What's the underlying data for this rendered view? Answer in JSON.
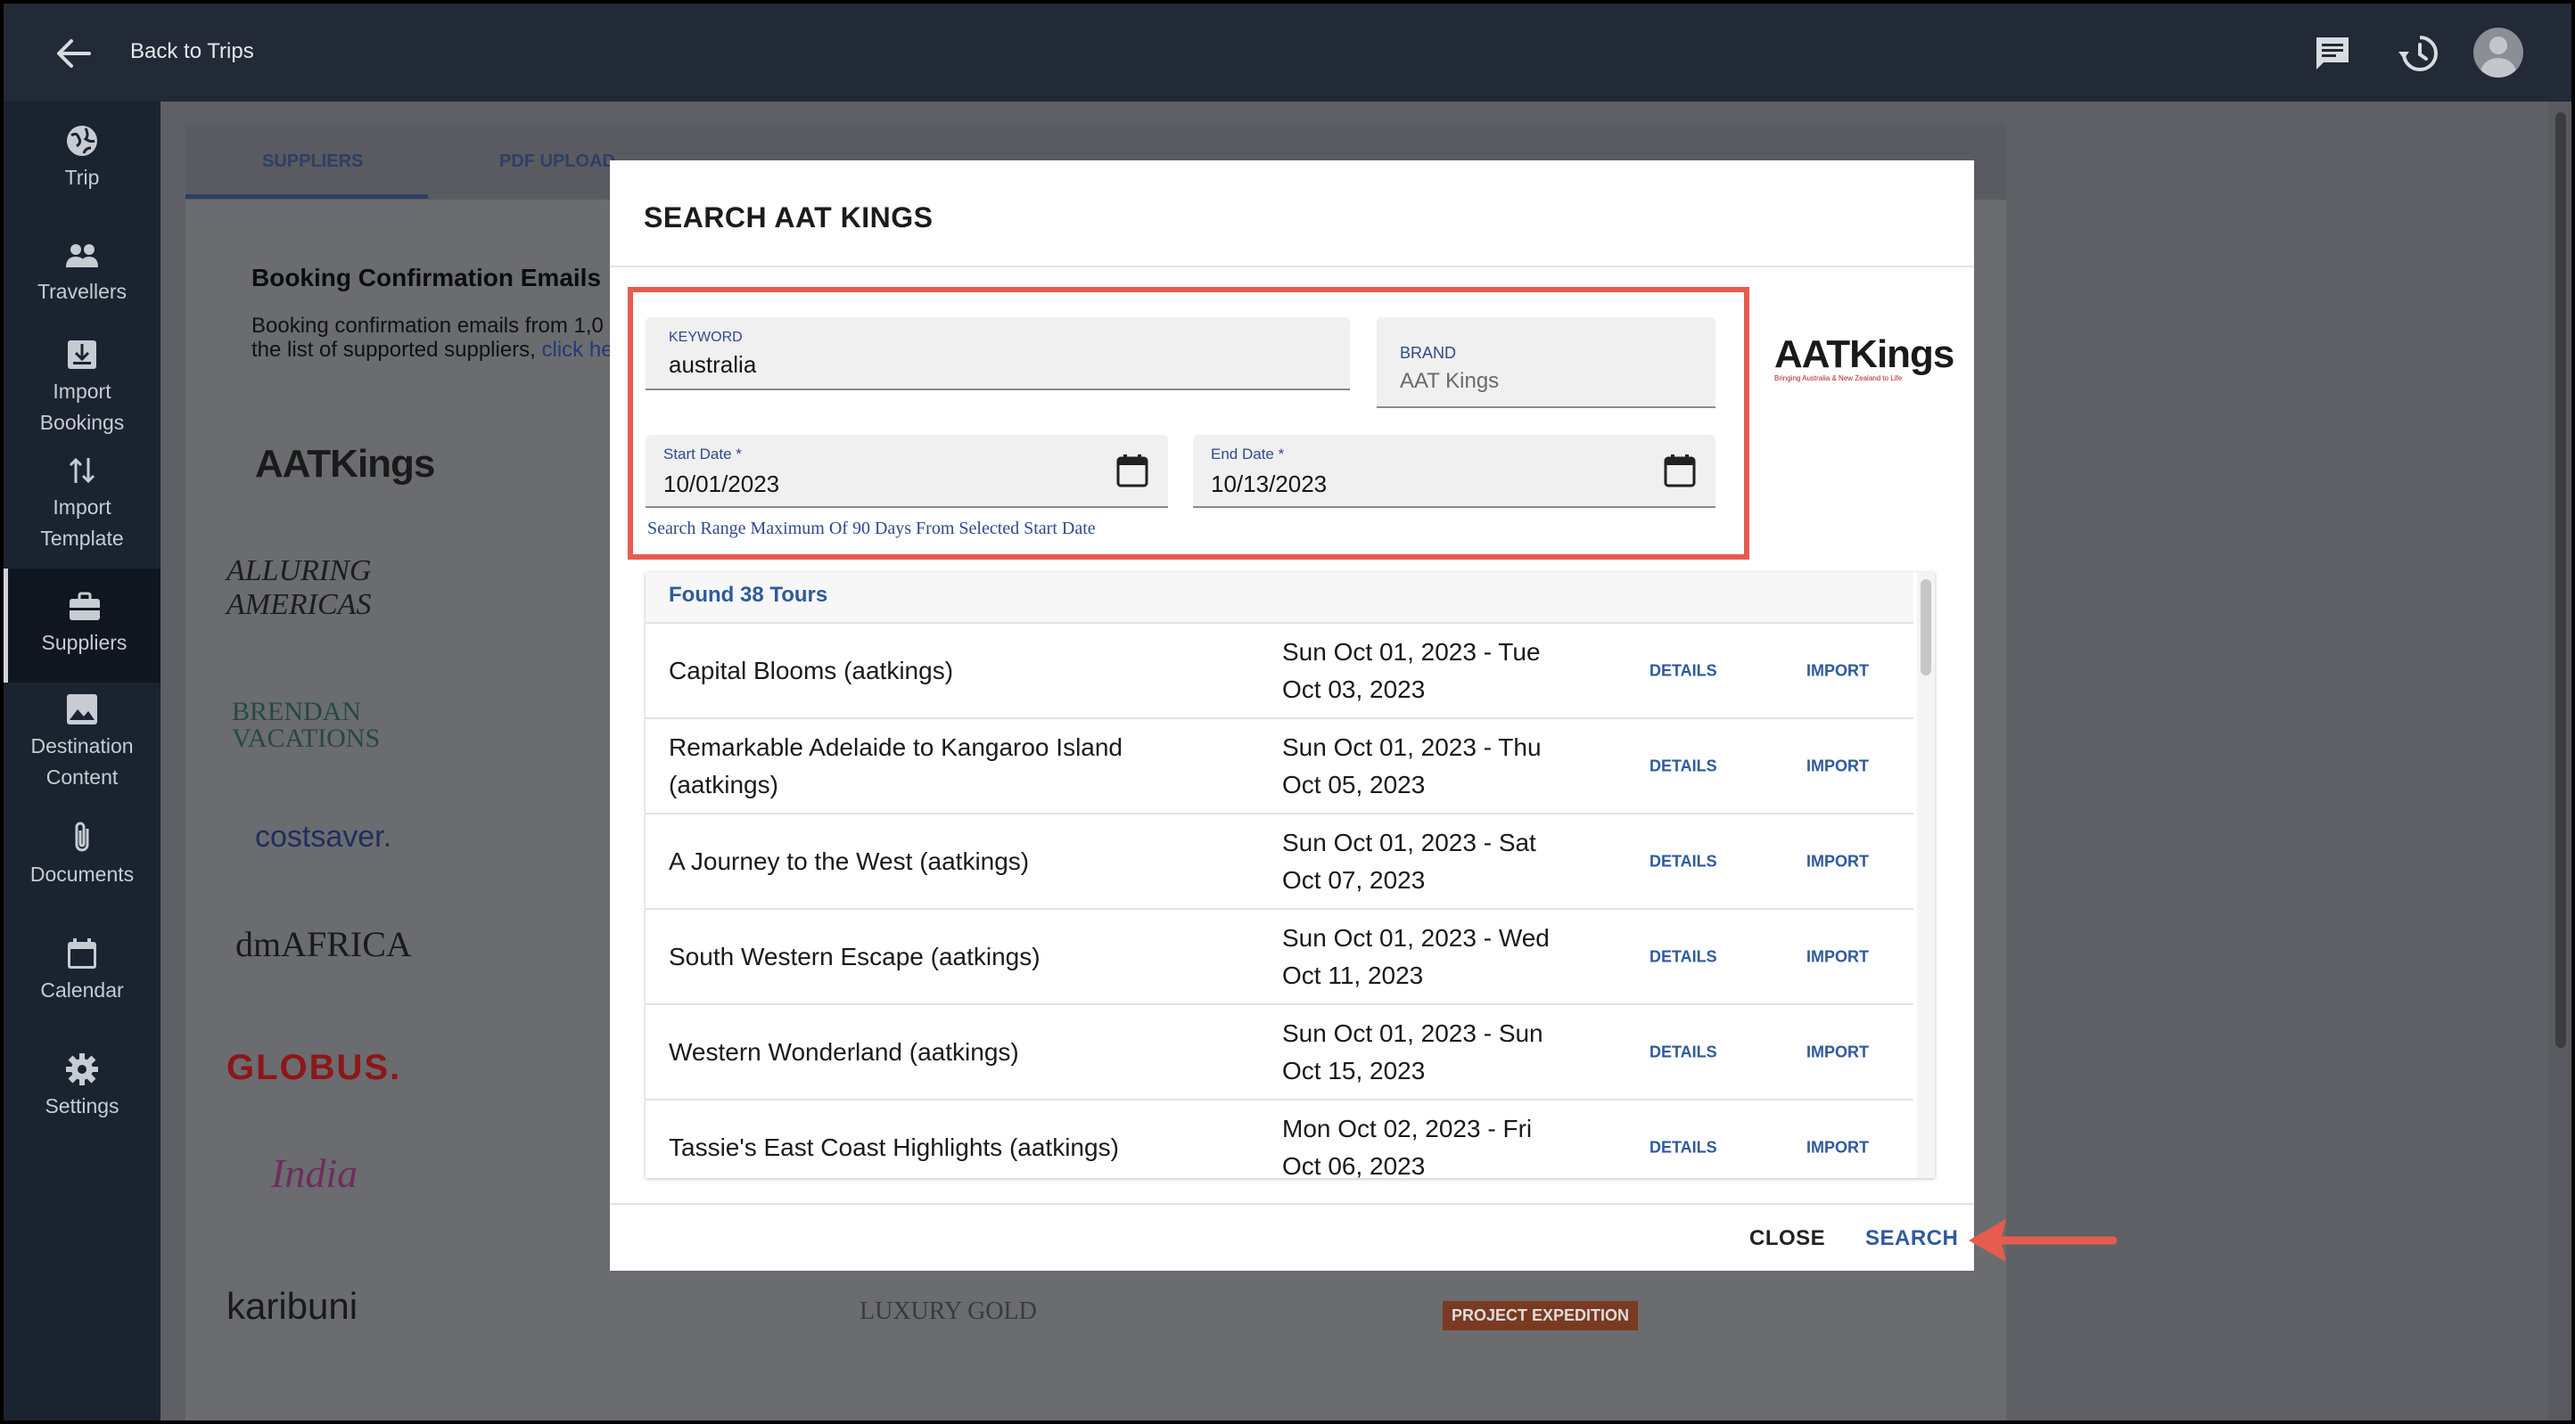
{
  "topbar": {
    "back_label": "Back to Trips",
    "icons": [
      "arrow-left-icon",
      "chat-icon",
      "history-icon",
      "user-avatar"
    ]
  },
  "sidebar": {
    "items": [
      {
        "label": "Trip",
        "icon": "globe-icon"
      },
      {
        "label": "Travellers",
        "icon": "people-icon"
      },
      {
        "label": "Import Bookings",
        "icon": "import-icon"
      },
      {
        "label": "Import Template",
        "icon": "sort-arrows-icon"
      },
      {
        "label": "Suppliers",
        "icon": "briefcase-icon",
        "active": true
      },
      {
        "label": "Destination Content",
        "icon": "image-icon"
      },
      {
        "label": "Documents",
        "icon": "paperclip-icon"
      },
      {
        "label": "Calendar",
        "icon": "calendar-icon"
      },
      {
        "label": "Settings",
        "icon": "gear-icon"
      }
    ]
  },
  "background": {
    "tabs": [
      "SUPPLIERS",
      "PDF UPLOAD"
    ],
    "section_title": "Booking Confirmation Emails",
    "section_desc_line1": "Booking confirmation emails from 1,0",
    "section_desc_line2": "the list of supported suppliers, ",
    "section_desc_link": "click he",
    "logos": [
      "AATKings",
      "ALLURING AMERICAS",
      "BRENDAN VACATIONS",
      "costsaver.",
      "dmAFRICA",
      "GLOBUS.",
      "India",
      "karibuni",
      "LUXURY GOLD",
      "PROJECT EXPEDITION"
    ]
  },
  "modal": {
    "title": "SEARCH AAT KINGS",
    "keyword": {
      "label": "KEYWORD",
      "value": "australia"
    },
    "brand": {
      "label": "BRAND",
      "value": "AAT Kings"
    },
    "start_date": {
      "label": "Start Date *",
      "value": "10/01/2023"
    },
    "end_date": {
      "label": "End Date *",
      "value": "10/13/2023"
    },
    "hint": "Search Range Maximum Of 90 Days From Selected Start Date",
    "brand_logo": {
      "text": "AATKings",
      "tagline": "Bringing Australia & New Zealand to Life"
    },
    "results_count": "Found 38 Tours",
    "details_label": "DETAILS",
    "import_label": "IMPORT",
    "rows": [
      {
        "name": "Capital Blooms (aatkings)",
        "dates": "Sun Oct 01, 2023 - Tue Oct 03, 2023"
      },
      {
        "name": "Remarkable Adelaide to Kangaroo Island (aatkings)",
        "dates": "Sun Oct 01, 2023 - Thu Oct 05, 2023"
      },
      {
        "name": "A Journey to the West (aatkings)",
        "dates": "Sun Oct 01, 2023 - Sat Oct 07, 2023"
      },
      {
        "name": "South Western Escape (aatkings)",
        "dates": "Sun Oct 01, 2023 - Wed Oct 11, 2023"
      },
      {
        "name": "Western Wonderland (aatkings)",
        "dates": "Sun Oct 01, 2023 - Sun Oct 15, 2023"
      },
      {
        "name": "Tassie's East Coast Highlights (aatkings)",
        "dates": "Mon Oct 02, 2023 - Fri Oct 06, 2023"
      }
    ],
    "close_label": "CLOSE",
    "search_label": "SEARCH"
  },
  "colors": {
    "highlight": "#e65c4f",
    "accent": "#2f5a9e",
    "sidebar_bg": "#1a2330",
    "topbar_bg": "#222a37"
  }
}
